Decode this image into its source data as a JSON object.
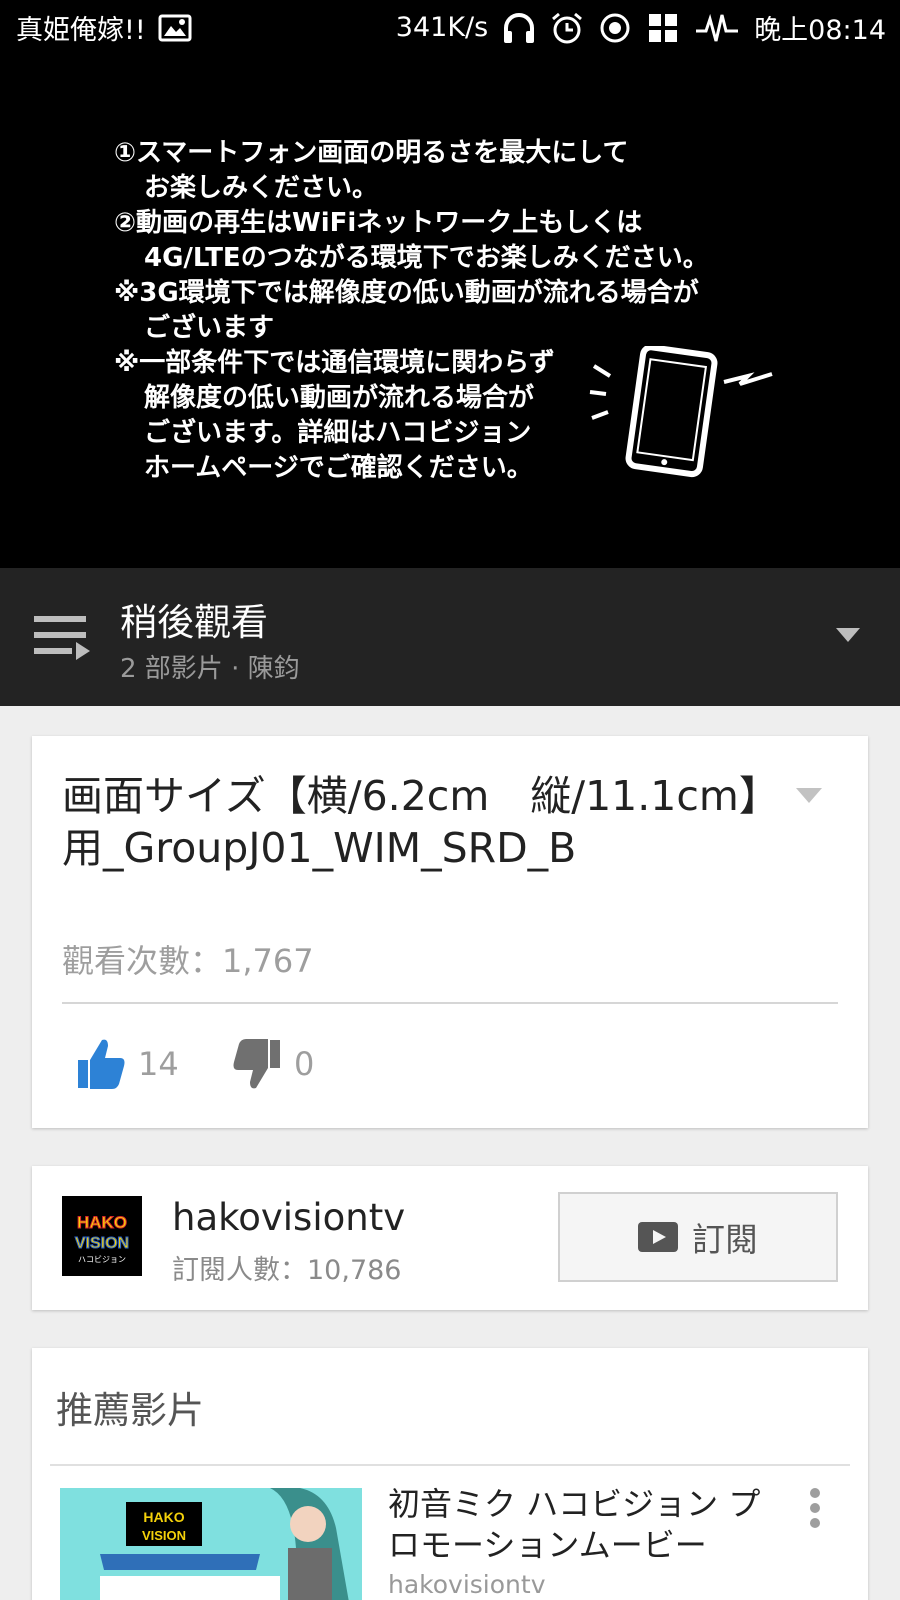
{
  "status_bar": {
    "carrier_text": "真姫俺嫁!!",
    "speed": "341K/s",
    "time": "晚上08:14"
  },
  "video": {
    "notice_lines": [
      "①スマートフォン画面の明るさを最大にして",
      "お楽しみください。",
      "②動画の再生はWiFiネットワーク上もしくは",
      "4G/LTEのつながる環境下でお楽しみください。",
      "※3G環境下では解像度の低い動画が流れる場合が",
      "ございます",
      "※一部条件下では通信環境に関わらず",
      "解像度の低い動画が流れる場合が",
      "ございます。詳細はハコビジョン",
      "ホームページでご確認ください。"
    ]
  },
  "playlist": {
    "title": "稍後觀看",
    "subtitle": "2 部影片 · 陳鈞"
  },
  "video_info": {
    "title": "画面サイズ【横/6.2cm　縦/11.1cm】用_GroupJ01_WIM_SRD_B",
    "views": "觀看次數：1,767",
    "likes": "14",
    "dislikes": "0",
    "like_color": "#2d82d6"
  },
  "channel": {
    "name": "hakovisiontv",
    "subscribers": "訂閱人數：10,786",
    "subscribe_label": "訂閱",
    "logo_text_top": "HAKO",
    "logo_text_mid": "VISION",
    "logo_text_bottom": "ハコビジョン"
  },
  "recommended": {
    "heading": "推薦影片",
    "items": [
      {
        "title": "初音ミク ハコビジョン プロモーションムービー",
        "channel": "hakovisiontv"
      }
    ]
  }
}
